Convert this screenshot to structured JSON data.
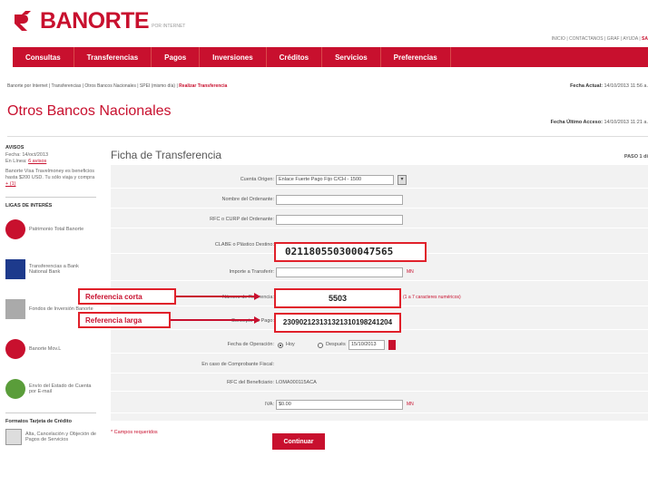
{
  "header": {
    "brand": "BANORTE",
    "brand_sub": "POR INTERNET",
    "top_links": "INICIO | CONTACTANOS | GRAF | AYUDA |",
    "top_links_last": "SA"
  },
  "nav": [
    "Consultas",
    "Transferencias",
    "Pagos",
    "Inversiones",
    "Créditos",
    "Servicios",
    "Preferencias"
  ],
  "breadcrumb": {
    "path": "Banorte por Internet | Transferencias | Otros Bancos Nacionales | SPEI (mismo día) |",
    "current": "Realizar Transferencia"
  },
  "dates": {
    "actual_label": "Fecha Actual:",
    "actual_value": "14/10/2013 11:56 a.",
    "last_label": "Fecha Último Acceso:",
    "last_value": "14/10/2013 11:21 a."
  },
  "page_title": "Otros Bancos Nacionales",
  "sidebar": {
    "avisos_head": "AVISOS",
    "avisos_date": "Fecha: 14/oct/2013",
    "avisos_user": "En Línea:",
    "avisos_user_link": "6 avisos",
    "avisos_text": "Banorte Visa Travelmoney es beneficios hasta $200 USD. Tu sólo viaja y compra",
    "avisos_more": "+ (1)",
    "links_head": "LIGAS DE INTERÉS",
    "links": [
      "Patrimonio Total Banorte",
      "Transferencias a Bank National Bank",
      "Fondos de Inversión Banorte",
      "Banorte Mov.L",
      "Envío del Estado de Cuenta por E-mail"
    ],
    "formats_head": "Formatos Tarjeta de Crédito",
    "formats_item": "Alta, Cancelación y Objeción de Pagos de Servicios"
  },
  "form": {
    "title": "Ficha de Transferencia",
    "step": "PASO 1 di",
    "cuenta_origen_label": "Cuenta Origen:",
    "cuenta_origen_value": "Enlace Fuerte Pago Fijo C/CH - 1500",
    "nombre_label": "Nombre del Ordenante:",
    "rfc_label": "RFC o CURP del Ordenante:",
    "clabe_label": "CLABE o Plástico Destino:",
    "clabe_value": "021180550300047565",
    "importe_label": "Importe a Transferir:",
    "importe_suffix": "MN",
    "ref_label": "Número de Referencia:",
    "ref_value": "5503",
    "ref_hint": "(1 a 7 caracteres numéricos)",
    "concepto_label": "Concepto de Pago:",
    "concepto_value": "230902123131321310198241204",
    "fecha_label": "Fecha de Operación:",
    "fecha_hoy": "Hoy",
    "fecha_despues": "Después",
    "fecha_value": "15/10/2013",
    "comprobante_label": "En caso de Comprobante Fiscal:",
    "rfc_benef_label": "RFC del Beneficiario:",
    "rfc_benef_value": "LOMA000115ACA",
    "iva_label": "IVA:",
    "iva_value": "$0.00",
    "iva_suffix": "MN",
    "required_note": "* Campos requeridos",
    "continue_button": "Continuar"
  },
  "callouts": {
    "short": "Referencia corta",
    "long": "Referencia larga"
  },
  "colors": {
    "brand": "#c8102e",
    "highlight_border": "#e0202a",
    "form_bg": "#f2f2f2"
  }
}
